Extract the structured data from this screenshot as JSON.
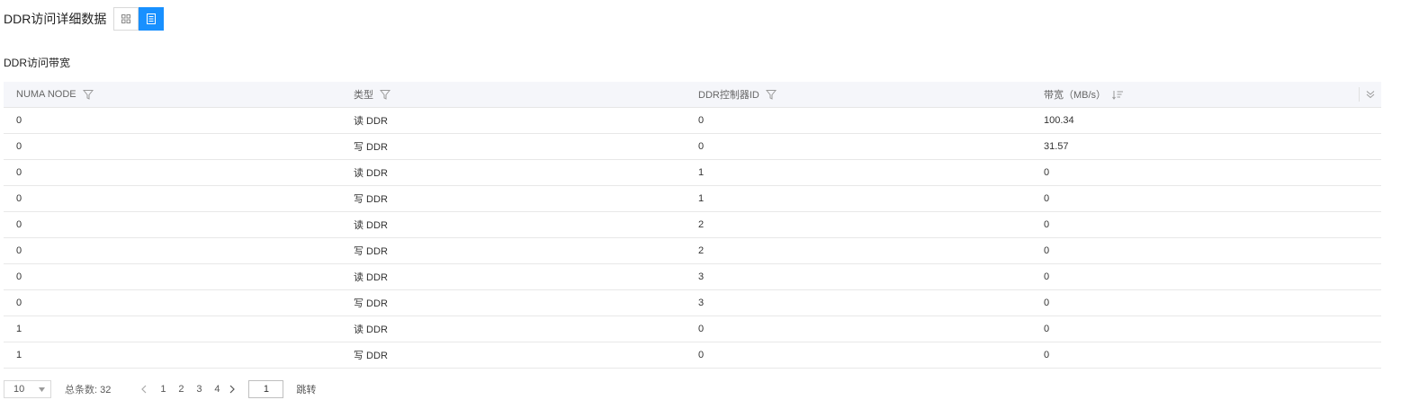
{
  "page": {
    "title": "DDR访问详细数据",
    "view_toggle": {
      "grid_icon": "grid-icon",
      "list_icon": "list-icon",
      "active": "list"
    }
  },
  "section": {
    "title": "DDR访问带宽"
  },
  "table": {
    "columns": [
      {
        "label": "NUMA NODE",
        "icon": "filter-icon"
      },
      {
        "label": "类型",
        "icon": "filter-icon"
      },
      {
        "label": "DDR控制器ID",
        "icon": "filter-icon"
      },
      {
        "label": "带宽（MB/s）",
        "icon": "sort-icon"
      }
    ],
    "rows": [
      [
        "0",
        "读 DDR",
        "0",
        "100.34"
      ],
      [
        "0",
        "写 DDR",
        "0",
        "31.57"
      ],
      [
        "0",
        "读 DDR",
        "1",
        "0"
      ],
      [
        "0",
        "写 DDR",
        "1",
        "0"
      ],
      [
        "0",
        "读 DDR",
        "2",
        "0"
      ],
      [
        "0",
        "写 DDR",
        "2",
        "0"
      ],
      [
        "0",
        "读 DDR",
        "3",
        "0"
      ],
      [
        "0",
        "写 DDR",
        "3",
        "0"
      ],
      [
        "1",
        "读 DDR",
        "0",
        "0"
      ],
      [
        "1",
        "写 DDR",
        "0",
        "0"
      ]
    ]
  },
  "pagination": {
    "page_size": "10",
    "total_label": "总条数:",
    "total": "32",
    "pages": [
      "1",
      "2",
      "3",
      "4"
    ],
    "jump_value": "1",
    "jump_label": "跳转"
  },
  "colors": {
    "accent": "#1890ff",
    "header_bg": "#f5f6fa",
    "border": "#e8e8e8"
  }
}
